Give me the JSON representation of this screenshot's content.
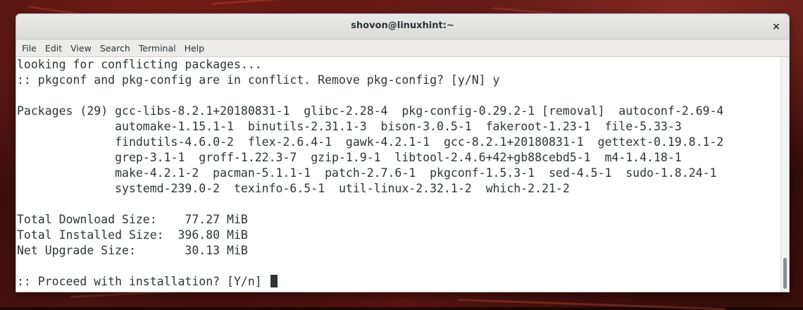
{
  "window": {
    "title": "shovon@linuxhint:~",
    "close_label": "×"
  },
  "menubar": {
    "items": [
      {
        "label": "File"
      },
      {
        "label": "Edit"
      },
      {
        "label": "View"
      },
      {
        "label": "Search"
      },
      {
        "label": "Terminal"
      },
      {
        "label": "Help"
      }
    ]
  },
  "terminal": {
    "lines": [
      "looking for conflicting packages...",
      ":: pkgconf and pkg-config are in conflict. Remove pkg-config? [y/N] y",
      "",
      "Packages (29) gcc-libs-8.2.1+20180831-1  glibc-2.28-4  pkg-config-0.29.2-1 [removal]  autoconf-2.69-4",
      "              automake-1.15.1-1  binutils-2.31.1-3  bison-3.0.5-1  fakeroot-1.23-1  file-5.33-3",
      "              findutils-4.6.0-2  flex-2.6.4-1  gawk-4.2.1-1  gcc-8.2.1+20180831-1  gettext-0.19.8.1-2",
      "              grep-3.1-1  groff-1.22.3-7  gzip-1.9-1  libtool-2.4.6+42+gb88cebd5-1  m4-1.4.18-1",
      "              make-4.2.1-2  pacman-5.1.1-1  patch-2.7.6-1  pkgconf-1.5.3-1  sed-4.5-1  sudo-1.8.24-1",
      "              systemd-239.0-2  texinfo-6.5-1  util-linux-2.32.1-2  which-2.21-2",
      "",
      "Total Download Size:    77.27 MiB",
      "Total Installed Size:  396.80 MiB",
      "Net Upgrade Size:       30.13 MiB",
      "",
      ":: Proceed with installation? [Y/n] "
    ]
  }
}
